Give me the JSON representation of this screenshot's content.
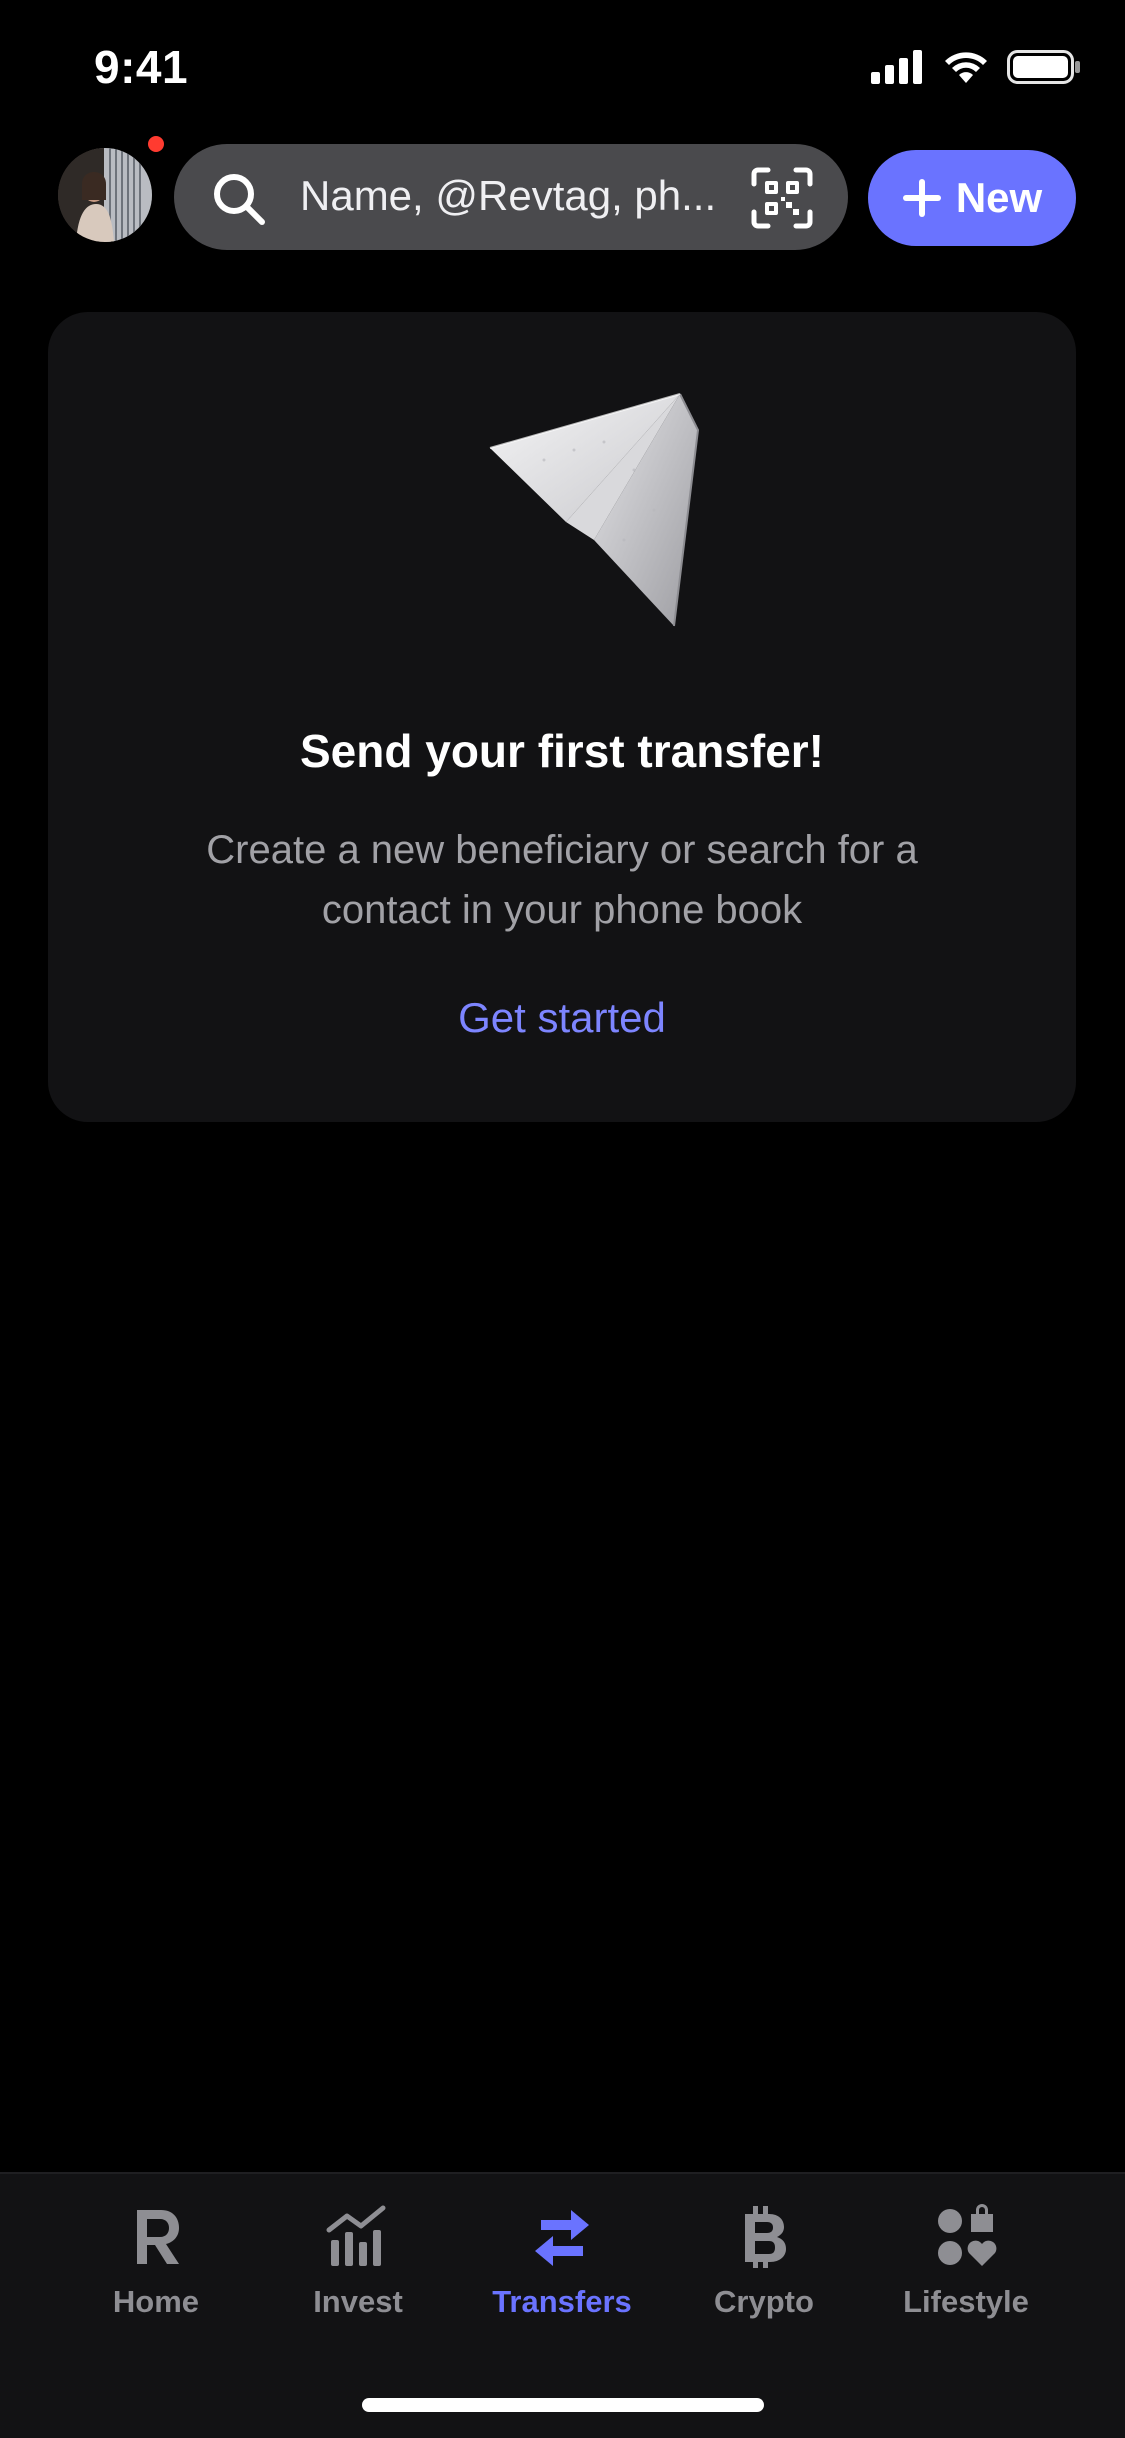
{
  "status": {
    "time": "9:41"
  },
  "header": {
    "search_placeholder": "Name, @Revtag, ph...",
    "new_button_label": "New",
    "icons": {
      "search": "search-icon",
      "qr": "qr-code-icon",
      "plus": "plus-icon"
    }
  },
  "card": {
    "title": "Send your first transfer!",
    "description": "Create a new beneficiary or search for a contact in your phone book",
    "link": "Get started",
    "illustration": "paper-plane-icon"
  },
  "tabbar": {
    "tabs": [
      {
        "label": "Home",
        "icon": "revolut-r-icon",
        "active": false
      },
      {
        "label": "Invest",
        "icon": "chart-icon",
        "active": false
      },
      {
        "label": "Transfers",
        "icon": "transfer-arrows-icon",
        "active": true
      },
      {
        "label": "Crypto",
        "icon": "bitcoin-icon",
        "active": false
      },
      {
        "label": "Lifestyle",
        "icon": "lifestyle-icon",
        "active": false
      }
    ]
  },
  "colors": {
    "accent": "#6a73ff",
    "link": "#7d85ff",
    "background": "#000000",
    "card": "#121214",
    "notification": "#ff3b30"
  }
}
